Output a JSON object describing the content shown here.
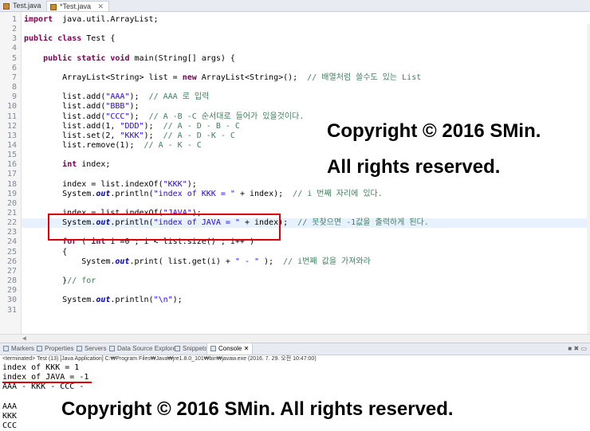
{
  "tabs": [
    {
      "label": "Test.java",
      "active": false
    },
    {
      "label": "*Test.java",
      "active": true
    }
  ],
  "tab_close_glyph": "✕",
  "editor": {
    "current_line": 22,
    "lines": [
      {
        "n": "1",
        "segs": [
          [
            "kw",
            "import"
          ],
          [
            "",
            "  java.util.ArrayList;"
          ]
        ]
      },
      {
        "n": "2",
        "segs": []
      },
      {
        "n": "3",
        "segs": [
          [
            "kw",
            "public"
          ],
          [
            "",
            ""
          ],
          [
            "kw",
            " class"
          ],
          [
            "",
            " Test {"
          ]
        ]
      },
      {
        "n": "4",
        "segs": []
      },
      {
        "n": "5",
        "segs": [
          [
            "",
            "    "
          ],
          [
            "kw",
            "public"
          ],
          [
            "",
            " "
          ],
          [
            "kw",
            "static"
          ],
          [
            "",
            " "
          ],
          [
            "kw",
            "void"
          ],
          [
            "",
            " main(String[] args) {"
          ]
        ]
      },
      {
        "n": "6",
        "segs": []
      },
      {
        "n": "7",
        "segs": [
          [
            "",
            "        ArrayList<String> list = "
          ],
          [
            "kw",
            "new"
          ],
          [
            "",
            " ArrayList<String>();  "
          ],
          [
            "cmt",
            "// 배열처럼 쓸수도 있는 List"
          ]
        ]
      },
      {
        "n": "8",
        "segs": []
      },
      {
        "n": "9",
        "segs": [
          [
            "",
            "        list.add("
          ],
          [
            "str",
            "\"AAA\""
          ],
          [
            "",
            ");  "
          ],
          [
            "cmt",
            "// AAA 로 입력"
          ]
        ]
      },
      {
        "n": "10",
        "segs": [
          [
            "",
            "        list.add("
          ],
          [
            "str",
            "\"BBB\""
          ],
          [
            "",
            ");"
          ]
        ]
      },
      {
        "n": "11",
        "segs": [
          [
            "",
            "        list.add("
          ],
          [
            "str",
            "\"CCC\""
          ],
          [
            "",
            ");  "
          ],
          [
            "cmt",
            "// A -B -C 순서대로 들어가 있을것이다."
          ]
        ]
      },
      {
        "n": "12",
        "segs": [
          [
            "",
            "        list.add(1, "
          ],
          [
            "str",
            "\"DDD\""
          ],
          [
            "",
            ");  "
          ],
          [
            "cmt",
            "// A - D - B - C"
          ]
        ]
      },
      {
        "n": "13",
        "segs": [
          [
            "",
            "        list.set(2, "
          ],
          [
            "str",
            "\"KKK\""
          ],
          [
            "",
            ");  "
          ],
          [
            "cmt",
            "// A - D -K - C"
          ]
        ]
      },
      {
        "n": "14",
        "segs": [
          [
            "",
            "        list.remove(1);  "
          ],
          [
            "cmt",
            "// A - K - C"
          ]
        ]
      },
      {
        "n": "15",
        "segs": []
      },
      {
        "n": "16",
        "segs": [
          [
            "",
            "        "
          ],
          [
            "kw",
            "int"
          ],
          [
            "",
            " index;"
          ]
        ]
      },
      {
        "n": "17",
        "segs": []
      },
      {
        "n": "18",
        "segs": [
          [
            "",
            "        index = list.indexOf("
          ],
          [
            "str",
            "\"KKK\""
          ],
          [
            "",
            ");"
          ]
        ]
      },
      {
        "n": "19",
        "segs": [
          [
            "",
            "        System."
          ],
          [
            "fld",
            "out"
          ],
          [
            "",
            ".println("
          ],
          [
            "str",
            "\"index of KKK = \""
          ],
          [
            "",
            " + index);  "
          ],
          [
            "cmt",
            "// i 번째 자리에 있다."
          ]
        ]
      },
      {
        "n": "20",
        "segs": []
      },
      {
        "n": "21",
        "segs": [
          [
            "",
            "        index = list.indexOf("
          ],
          [
            "str",
            "\"JAVA\""
          ],
          [
            "",
            ");"
          ]
        ]
      },
      {
        "n": "22",
        "segs": [
          [
            "",
            "        System."
          ],
          [
            "fld",
            "out"
          ],
          [
            "",
            ".println("
          ],
          [
            "str",
            "\"index of JAVA = \""
          ],
          [
            "",
            " + index);  "
          ],
          [
            "cmt",
            "// 못찾으면 -1값을 출력하게 된다."
          ]
        ]
      },
      {
        "n": "23",
        "segs": []
      },
      {
        "n": "24",
        "segs": [
          [
            "",
            "        "
          ],
          [
            "kw",
            "for"
          ],
          [
            "",
            " ( "
          ],
          [
            "kw",
            "int"
          ],
          [
            "",
            " i =0 ; i < list.size() ; i++ )"
          ]
        ]
      },
      {
        "n": "25",
        "segs": [
          [
            "",
            "        {"
          ]
        ]
      },
      {
        "n": "26",
        "segs": [
          [
            "",
            "            System."
          ],
          [
            "fld",
            "out"
          ],
          [
            "",
            ".print( list.get(i) + "
          ],
          [
            "str",
            "\" - \""
          ],
          [
            "",
            " );  "
          ],
          [
            "cmt",
            "// i번째 값을 가져와라"
          ]
        ]
      },
      {
        "n": "27",
        "segs": []
      },
      {
        "n": "28",
        "segs": [
          [
            "",
            "        }"
          ],
          [
            "cmt",
            "// for"
          ]
        ]
      },
      {
        "n": "29",
        "segs": []
      },
      {
        "n": "30",
        "segs": [
          [
            "",
            "        System."
          ],
          [
            "fld",
            "out"
          ],
          [
            "",
            ".println("
          ],
          [
            "str",
            "\"\\n\""
          ],
          [
            "",
            ");"
          ]
        ]
      },
      {
        "n": "31",
        "segs": []
      }
    ]
  },
  "watermark": {
    "line1": "Copyright © 2016 SMin.",
    "line2": "All rights reserved.",
    "bottom": "Copyright © 2016 SMin. All rights reserved."
  },
  "views": {
    "tabs": [
      "Markers",
      "Properties",
      "Servers",
      "Data Source Explorer",
      "Snippets",
      "Console"
    ],
    "active": "Console",
    "close_glyph": "✕"
  },
  "console": {
    "header": "<terminated> Test (13) [Java Application] C:₩Program Files₩Java₩jre1.8.0_101₩bin₩javaw.exe (2016. 7. 29. 오전 10:47:00)",
    "output": [
      "index of KKK = 1",
      "index of JAVA = -1",
      "AAA - KKK - CCC -",
      "",
      "AAA",
      "KKK",
      "CCC"
    ]
  },
  "colors": {
    "annotation_red": "#e0000a",
    "keyword": "#7f0055",
    "string": "#2a00ff",
    "comment": "#3f7f5f"
  }
}
